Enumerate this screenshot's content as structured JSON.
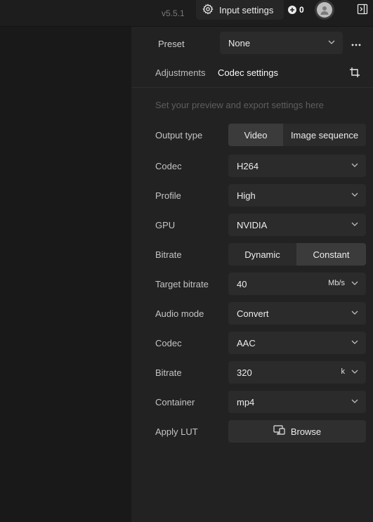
{
  "topbar": {
    "version": "v5.5.1",
    "input_settings_label": "Input settings",
    "credits": "0"
  },
  "preset": {
    "label": "Preset",
    "value": "None"
  },
  "tabs": {
    "adjustments": "Adjustments",
    "codec_settings": "Codec settings"
  },
  "hint": "Set your preview and export settings here",
  "rows": {
    "output_type": {
      "label": "Output type",
      "options": [
        "Video",
        "Image sequence"
      ],
      "selected": "Video"
    },
    "codec": {
      "label": "Codec",
      "value": "H264"
    },
    "profile": {
      "label": "Profile",
      "value": "High"
    },
    "gpu": {
      "label": "GPU",
      "value": "NVIDIA"
    },
    "bitrate_mode": {
      "label": "Bitrate",
      "options": [
        "Dynamic",
        "Constant"
      ],
      "selected": "Constant"
    },
    "target_bitrate": {
      "label": "Target bitrate",
      "value": "40",
      "unit": "Mb/s"
    },
    "audio_mode": {
      "label": "Audio mode",
      "value": "Convert"
    },
    "audio_codec": {
      "label": "Codec",
      "value": "AAC"
    },
    "audio_bitrate": {
      "label": "Bitrate",
      "value": "320",
      "unit": "k"
    },
    "container": {
      "label": "Container",
      "value": "mp4"
    },
    "apply_lut": {
      "label": "Apply LUT",
      "button": "Browse"
    }
  }
}
